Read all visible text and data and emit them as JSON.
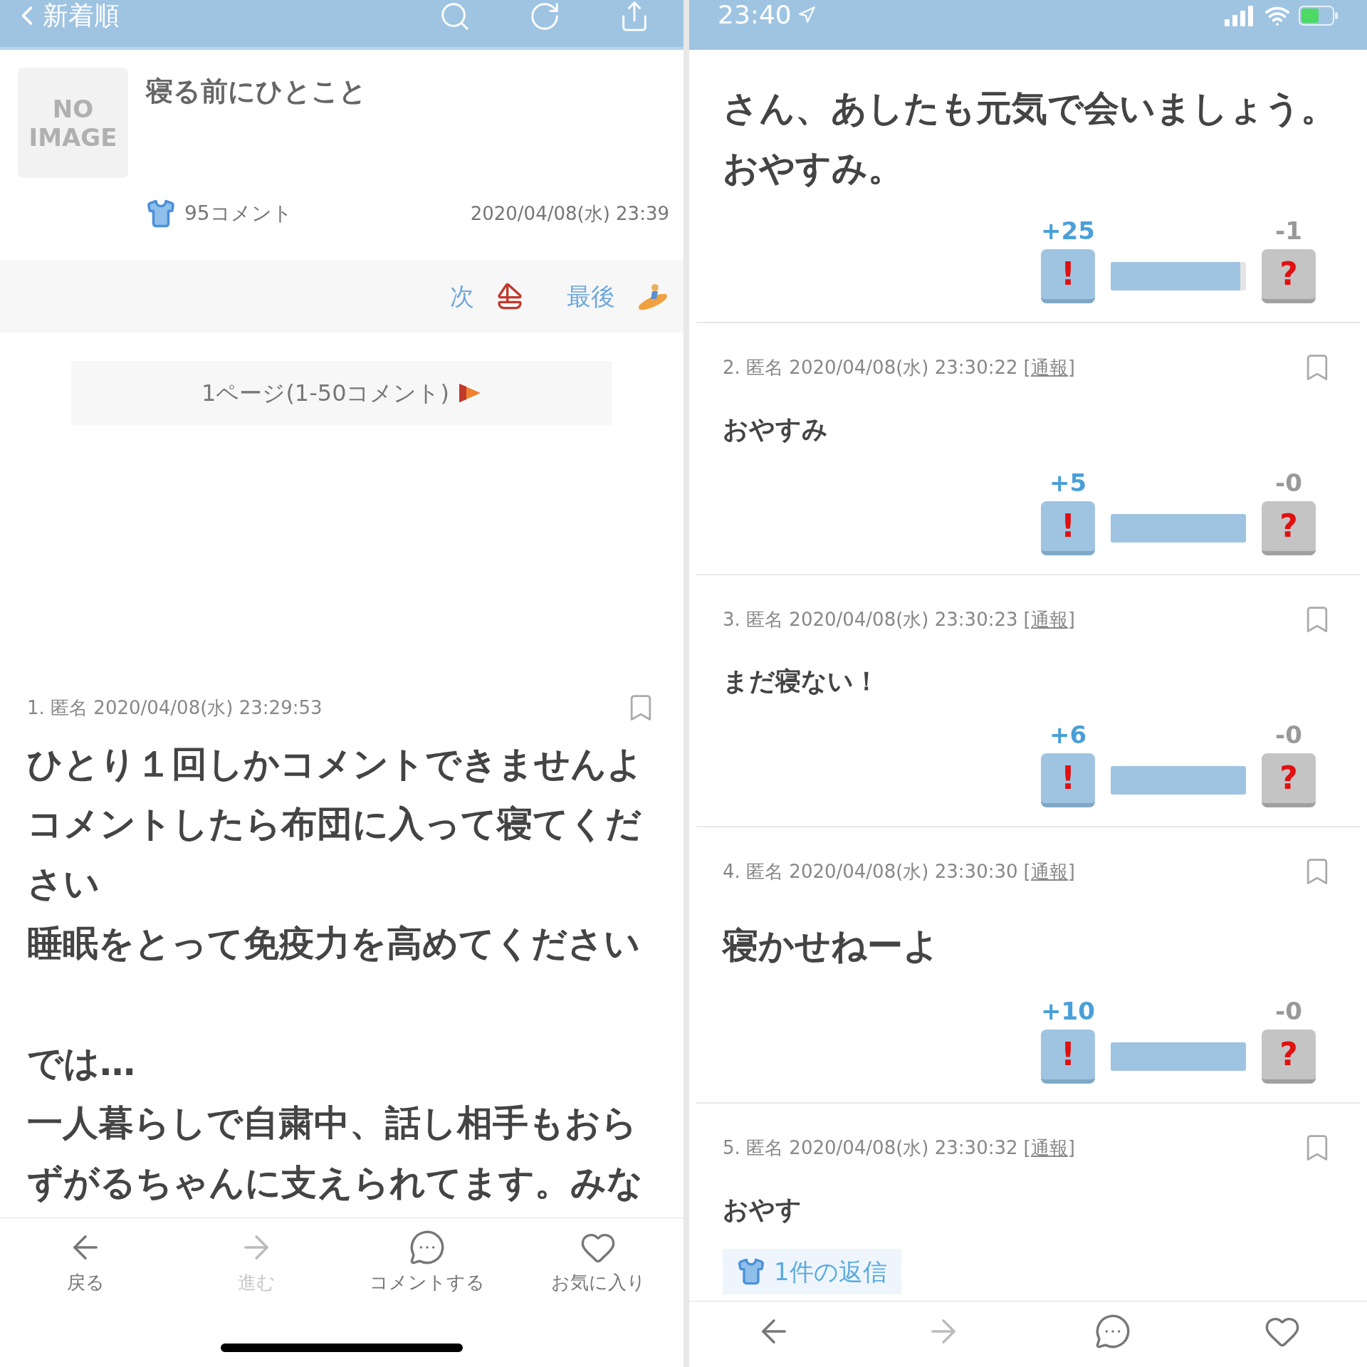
{
  "left_screen": {
    "nav_bar": {
      "back_label": "新着順"
    },
    "thread": {
      "thumbnail_text": "NO IMAGE",
      "title": "寝る前にひとこと",
      "comment_count": "95コメント",
      "date": "2020/04/08(水) 23:39"
    },
    "pager": [
      {
        "label": "次",
        "kind": "next"
      },
      {
        "label": "最後",
        "kind": "last"
      }
    ],
    "page_button": "1ページ(1-50コメント)",
    "comment": {
      "meta": "1. 匿名 2020/04/08(水) 23:29:53",
      "large": true,
      "sections": [
        [
          "ひとり１回しかコメントできませんよ",
          "コメントしたら布団に入って寝てください",
          "睡眠をとって免疫力を高めてください"
        ],
        [
          "では…",
          "一人暮らしで自粛中、話し相手もおら",
          "ずがるちゃんに支えられてます。みな"
        ]
      ]
    },
    "toolbar": [
      {
        "kind": "back",
        "label": "戻る",
        "disabled": false
      },
      {
        "kind": "forward",
        "label": "進む",
        "disabled": true
      },
      {
        "kind": "comment",
        "label": "コメントする",
        "disabled": false
      },
      {
        "kind": "favorite",
        "label": "お気に入り",
        "disabled": false
      }
    ]
  },
  "right_screen": {
    "status_bar": {
      "time": "23:40"
    },
    "first_comment_tail": {
      "large": true,
      "sections": [
        [
          "さん、あしたも元気で会いましょう。",
          "おやすみ。"
        ]
      ],
      "votes": {
        "plus": "+25",
        "agree_label": "!",
        "minus": "-1",
        "doubt_label": "?",
        "level": 0.96
      }
    },
    "comments": [
      {
        "meta": "2. 匿名 2020/04/08(水) 23:30:22",
        "report": "[通報]",
        "large": false,
        "sections": [
          [
            "おやすみ"
          ]
        ],
        "votes": {
          "plus": "+5",
          "agree_label": "!",
          "minus": "-0",
          "doubt_label": "?",
          "level": 1
        }
      },
      {
        "meta": "3. 匿名 2020/04/08(水) 23:30:23",
        "report": "[通報]",
        "large": false,
        "sections": [
          [
            "まだ寝ない！"
          ]
        ],
        "votes": {
          "plus": "+6",
          "agree_label": "!",
          "minus": "-0",
          "doubt_label": "?",
          "level": 1
        }
      },
      {
        "meta": "4. 匿名 2020/04/08(水) 23:30:30",
        "report": "[通報]",
        "large": true,
        "sections": [
          [
            "寝かせねーよ"
          ]
        ],
        "votes": {
          "plus": "+10",
          "agree_label": "!",
          "minus": "-0",
          "doubt_label": "?",
          "level": 1
        }
      },
      {
        "meta": "5. 匿名 2020/04/08(水) 23:30:32",
        "report": "[通報]",
        "large": false,
        "sections": [
          [
            "おやす"
          ]
        ],
        "replies": "1件の返信"
      }
    ],
    "toolbar": [
      {
        "kind": "back",
        "disabled": false
      },
      {
        "kind": "forward",
        "disabled": true
      },
      {
        "kind": "comment",
        "disabled": false
      },
      {
        "kind": "favorite",
        "disabled": false
      }
    ]
  }
}
